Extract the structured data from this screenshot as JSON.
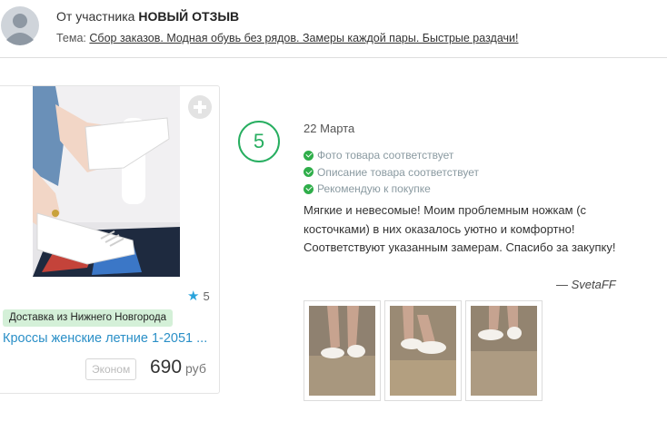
{
  "header": {
    "prefix": "От участника",
    "title": "НОВЫЙ ОТЗЫВ",
    "topic_label": "Тема:",
    "topic_link": "Сбор заказов. Модная обувь без рядов. Замеры каждой пары. Быстрые раздачи!"
  },
  "product": {
    "rating": "5",
    "delivery": "Доставка из Нижнего Новгорода",
    "title": "Кроссы женские летние 1-2051 ...",
    "tag": "Эконом",
    "price": "690",
    "currency": "руб"
  },
  "review": {
    "score": "5",
    "date": "22 Марта",
    "checks": [
      "Фото товара соответствует",
      "Описание товара соответствует",
      "Рекомендую к покупке"
    ],
    "text": "Мягкие и невесомые! Моим проблемным ножкам (с косточками) в них оказалось уютно и комфортно! Соответствуют указанным замерам. Спасибо за закупку!",
    "author": "— SvetaFF"
  },
  "colors": {
    "accent_green": "#27ae60",
    "link_blue": "#2a8fc7",
    "delivery_bg": "#d4f0d8"
  }
}
